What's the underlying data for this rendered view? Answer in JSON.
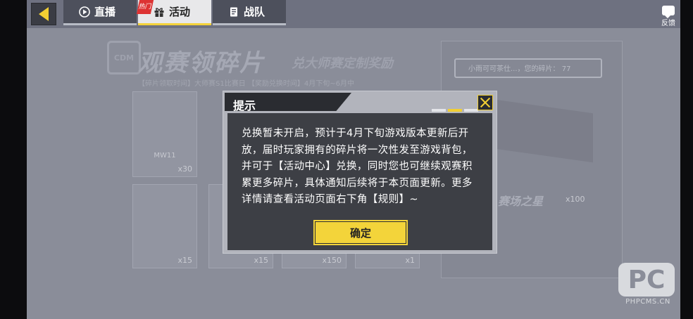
{
  "topbar": {
    "tabs": [
      {
        "label": "直播",
        "icon": "play-circle-icon"
      },
      {
        "label": "活动",
        "icon": "gift-icon",
        "badge": "热门"
      },
      {
        "label": "战队",
        "icon": "team-icon"
      }
    ],
    "feedback_label": "反馈"
  },
  "background": {
    "logo": "CDM",
    "title": "观赛领碎片",
    "subtitle": "兑大师赛定制奖励",
    "date_line": "【碎片领取时间】大师赛S1比赛日   【奖励兑换时间】4月下旬~6月中",
    "cards": [
      {
        "name": "MW11",
        "count": "x30"
      },
      {
        "name": "",
        "count": "x15"
      },
      {
        "name": "",
        "count": "x15"
      },
      {
        "name": "",
        "count": "x150"
      },
      {
        "name": "",
        "count": "x1"
      }
    ],
    "right_panel": {
      "chip_text": "小雨可可茶仕...，您的碎片：",
      "chip_count": "77",
      "caption": "赛场之星",
      "count": "x100"
    }
  },
  "dialog": {
    "title": "提示",
    "body": "兑换暂未开启，预计于4月下旬游戏版本更新后开放，届时玩家拥有的碎片将一次性发至游戏背包，并可于【活动中心】兑换，同时您也可继续观赛积累更多碎片，具体通知后续将于本页面更新。更多详情请查看活动页面右下角【规则】~",
    "confirm_label": "确定"
  },
  "watermark": {
    "logo": "PC",
    "url": "PHPCMS.CN"
  },
  "colors": {
    "accent": "#f3d43a",
    "dialog_bg": "#3d3f45",
    "overlay": "#8a8d99"
  }
}
